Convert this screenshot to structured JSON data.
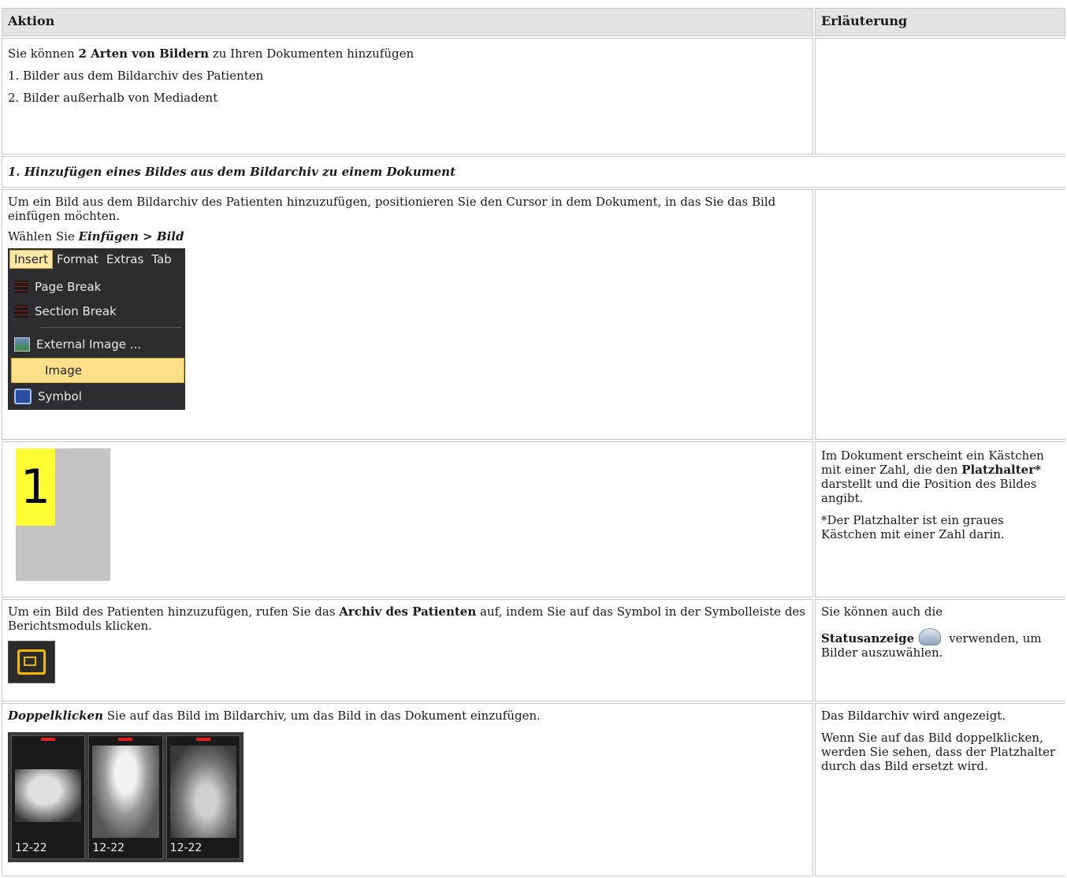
{
  "headers": {
    "action": "Aktion",
    "explanation": "Erläuterung"
  },
  "row1": {
    "intro_pre": "Sie können ",
    "intro_bold": "2 Arten von Bildern",
    "intro_post": " zu Ihren Dokumenten hinzufügen",
    "item1": "1. Bilder aus dem Bildarchiv des Patienten",
    "item2": "2. Bilder außerhalb von Mediadent"
  },
  "section1": {
    "title": "1. Hinzufügen eines Bildes aus dem Bildarchiv zu einem Dokument"
  },
  "row3": {
    "text1": "Um ein Bild aus dem Bildarchiv des Patienten hinzuzufügen, positionieren Sie den Cursor in dem Dokument, in das Sie das Bild einfügen möchten.",
    "select_pre": "Wählen Sie ",
    "select_bold": "Einfügen > Bild",
    "menu": {
      "bar": [
        "Insert",
        "Format",
        "Extras",
        "Tab"
      ],
      "items": [
        "Page Break",
        "Section Break",
        "External Image ...",
        "Image",
        "Symbol"
      ]
    }
  },
  "row4": {
    "placeholder_number": "1",
    "exp_pre": "Im Dokument erscheint ein Kästchen mit einer Zahl, die den ",
    "exp_bold": "Platzhalter*",
    "exp_post": " darstellt und die Position des Bildes angibt.",
    "note": "*Der Platzhalter ist ein graues Kästchen mit einer Zahl darin."
  },
  "row5": {
    "text_pre": "Um ein Bild des Patienten hinzuzufügen, rufen Sie das ",
    "text_bold": "Archiv des Patienten",
    "text_post": " auf, indem Sie auf das Symbol in der Symbolleiste des Berichtsmoduls klicken.",
    "exp_line1": "Sie können auch die",
    "exp_bold": "Statusanzeige",
    "exp_post": "verwenden, um Bilder auszuwählen."
  },
  "row6": {
    "text_bold": "Doppelklicken",
    "text_post": " Sie auf das Bild im Bildarchiv, um das Bild in das Dokument einzufügen.",
    "thumb_labels": [
      "12-22",
      "12-22",
      "12-22"
    ],
    "exp1": "Das Bildarchiv wird angezeigt.",
    "exp2": "Wenn Sie auf das Bild doppelklicken, werden Sie sehen, dass der Platzhalter durch das Bild ersetzt wird."
  }
}
